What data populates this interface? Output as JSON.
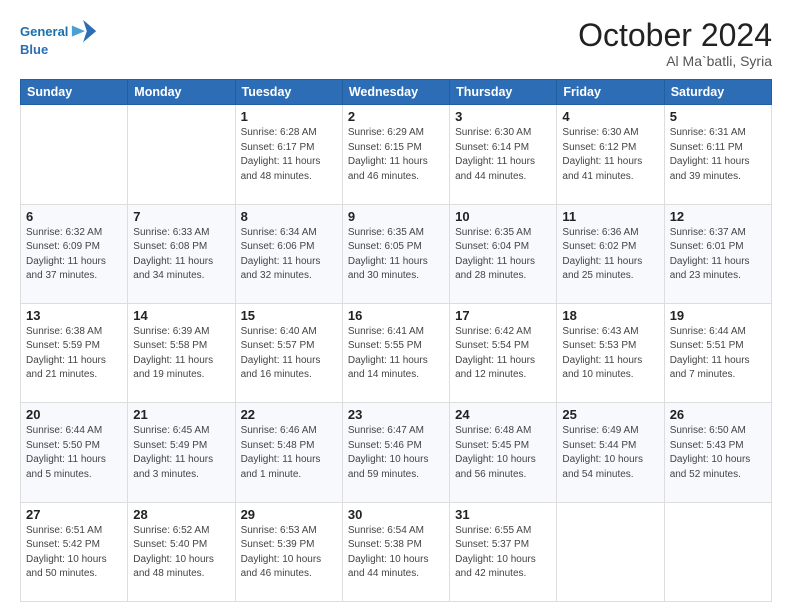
{
  "logo": {
    "line1": "General",
    "line2": "Blue",
    "icon": "🔷"
  },
  "header": {
    "month": "October 2024",
    "location": "Al Ma`batli, Syria"
  },
  "weekdays": [
    "Sunday",
    "Monday",
    "Tuesday",
    "Wednesday",
    "Thursday",
    "Friday",
    "Saturday"
  ],
  "weeks": [
    [
      {
        "day": "",
        "info": ""
      },
      {
        "day": "",
        "info": ""
      },
      {
        "day": "1",
        "info": "Sunrise: 6:28 AM\nSunset: 6:17 PM\nDaylight: 11 hours and 48 minutes."
      },
      {
        "day": "2",
        "info": "Sunrise: 6:29 AM\nSunset: 6:15 PM\nDaylight: 11 hours and 46 minutes."
      },
      {
        "day": "3",
        "info": "Sunrise: 6:30 AM\nSunset: 6:14 PM\nDaylight: 11 hours and 44 minutes."
      },
      {
        "day": "4",
        "info": "Sunrise: 6:30 AM\nSunset: 6:12 PM\nDaylight: 11 hours and 41 minutes."
      },
      {
        "day": "5",
        "info": "Sunrise: 6:31 AM\nSunset: 6:11 PM\nDaylight: 11 hours and 39 minutes."
      }
    ],
    [
      {
        "day": "6",
        "info": "Sunrise: 6:32 AM\nSunset: 6:09 PM\nDaylight: 11 hours and 37 minutes."
      },
      {
        "day": "7",
        "info": "Sunrise: 6:33 AM\nSunset: 6:08 PM\nDaylight: 11 hours and 34 minutes."
      },
      {
        "day": "8",
        "info": "Sunrise: 6:34 AM\nSunset: 6:06 PM\nDaylight: 11 hours and 32 minutes."
      },
      {
        "day": "9",
        "info": "Sunrise: 6:35 AM\nSunset: 6:05 PM\nDaylight: 11 hours and 30 minutes."
      },
      {
        "day": "10",
        "info": "Sunrise: 6:35 AM\nSunset: 6:04 PM\nDaylight: 11 hours and 28 minutes."
      },
      {
        "day": "11",
        "info": "Sunrise: 6:36 AM\nSunset: 6:02 PM\nDaylight: 11 hours and 25 minutes."
      },
      {
        "day": "12",
        "info": "Sunrise: 6:37 AM\nSunset: 6:01 PM\nDaylight: 11 hours and 23 minutes."
      }
    ],
    [
      {
        "day": "13",
        "info": "Sunrise: 6:38 AM\nSunset: 5:59 PM\nDaylight: 11 hours and 21 minutes."
      },
      {
        "day": "14",
        "info": "Sunrise: 6:39 AM\nSunset: 5:58 PM\nDaylight: 11 hours and 19 minutes."
      },
      {
        "day": "15",
        "info": "Sunrise: 6:40 AM\nSunset: 5:57 PM\nDaylight: 11 hours and 16 minutes."
      },
      {
        "day": "16",
        "info": "Sunrise: 6:41 AM\nSunset: 5:55 PM\nDaylight: 11 hours and 14 minutes."
      },
      {
        "day": "17",
        "info": "Sunrise: 6:42 AM\nSunset: 5:54 PM\nDaylight: 11 hours and 12 minutes."
      },
      {
        "day": "18",
        "info": "Sunrise: 6:43 AM\nSunset: 5:53 PM\nDaylight: 11 hours and 10 minutes."
      },
      {
        "day": "19",
        "info": "Sunrise: 6:44 AM\nSunset: 5:51 PM\nDaylight: 11 hours and 7 minutes."
      }
    ],
    [
      {
        "day": "20",
        "info": "Sunrise: 6:44 AM\nSunset: 5:50 PM\nDaylight: 11 hours and 5 minutes."
      },
      {
        "day": "21",
        "info": "Sunrise: 6:45 AM\nSunset: 5:49 PM\nDaylight: 11 hours and 3 minutes."
      },
      {
        "day": "22",
        "info": "Sunrise: 6:46 AM\nSunset: 5:48 PM\nDaylight: 11 hours and 1 minute."
      },
      {
        "day": "23",
        "info": "Sunrise: 6:47 AM\nSunset: 5:46 PM\nDaylight: 10 hours and 59 minutes."
      },
      {
        "day": "24",
        "info": "Sunrise: 6:48 AM\nSunset: 5:45 PM\nDaylight: 10 hours and 56 minutes."
      },
      {
        "day": "25",
        "info": "Sunrise: 6:49 AM\nSunset: 5:44 PM\nDaylight: 10 hours and 54 minutes."
      },
      {
        "day": "26",
        "info": "Sunrise: 6:50 AM\nSunset: 5:43 PM\nDaylight: 10 hours and 52 minutes."
      }
    ],
    [
      {
        "day": "27",
        "info": "Sunrise: 6:51 AM\nSunset: 5:42 PM\nDaylight: 10 hours and 50 minutes."
      },
      {
        "day": "28",
        "info": "Sunrise: 6:52 AM\nSunset: 5:40 PM\nDaylight: 10 hours and 48 minutes."
      },
      {
        "day": "29",
        "info": "Sunrise: 6:53 AM\nSunset: 5:39 PM\nDaylight: 10 hours and 46 minutes."
      },
      {
        "day": "30",
        "info": "Sunrise: 6:54 AM\nSunset: 5:38 PM\nDaylight: 10 hours and 44 minutes."
      },
      {
        "day": "31",
        "info": "Sunrise: 6:55 AM\nSunset: 5:37 PM\nDaylight: 10 hours and 42 minutes."
      },
      {
        "day": "",
        "info": ""
      },
      {
        "day": "",
        "info": ""
      }
    ]
  ]
}
